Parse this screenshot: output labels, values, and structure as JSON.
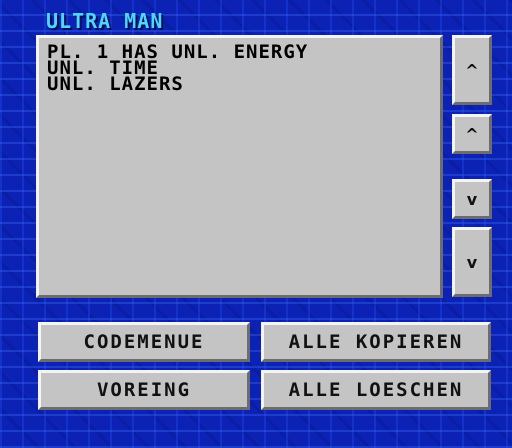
{
  "window": {
    "title": "ULTRA MAN"
  },
  "code_list": {
    "lines": [
      "PL. 1 HAS UNL. ENERGY",
      "UNL. TIME",
      "UNL. LAZERS"
    ]
  },
  "scroll_buttons": {
    "top": "^",
    "up": "^",
    "down": "v",
    "bottom": "v"
  },
  "actions": {
    "codemenue": "CODEMENUE",
    "alle_kopieren": "ALLE KOPIEREN",
    "voreing": "VOREING",
    "alle_loeschen": "ALLE LOESCHEN"
  },
  "colors": {
    "background": "#0c22b4",
    "title": "#4ed6ff",
    "panel": "#c4c4c4"
  }
}
